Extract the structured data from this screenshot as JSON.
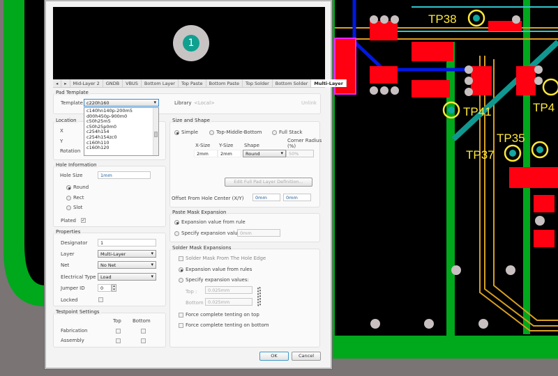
{
  "pcb": {
    "testpoints": [
      "TP38",
      "TP41",
      "TP4",
      "TP35",
      "TP37"
    ],
    "colors": {
      "board": "#000000",
      "edge": "#00a81c",
      "top": "#ff0010",
      "bottom": "#0018e0",
      "pad": "#c8c0c0",
      "testpoint_ring": "#ffe83a"
    }
  },
  "dialog": {
    "preview": {
      "designator": "1"
    },
    "tabs": [
      "◂",
      "▸",
      "Mid-Layer 2",
      "GNDB",
      "VBUS",
      "Bottom Layer",
      "Top Paste",
      "Bottom Paste",
      "Top Solder",
      "Bottom Solder",
      "Multi-Layer"
    ],
    "active_tab": "Multi-Layer",
    "pad_template": {
      "title": "Pad Template",
      "template_label": "Template",
      "template_value": "c220h160",
      "library_label": "Library",
      "library_value": "<Local>",
      "unlink": "Unlink",
      "options": [
        "c140hn140p-200m5",
        "d00h450p-900m0",
        "c50h25m5",
        "c50h25p0m0",
        "c254h154",
        "c254h154zc0",
        "c160h110",
        "c160h120"
      ]
    },
    "location": {
      "title": "Location",
      "x": "X",
      "y": "Y",
      "rotation": "Rotation"
    },
    "size_shape": {
      "title": "Size and Shape",
      "simple": "Simple",
      "tmb": "Top-Middle-Bottom",
      "full": "Full Stack",
      "xsize_label": "X-Size",
      "ysize_label": "Y-Size",
      "shape_label": "Shape",
      "corner_label": "Corner Radius (%)",
      "xsize": "2mm",
      "ysize": "2mm",
      "shape": "Round",
      "corner": "50%",
      "edit_btn": "Edit Full Pad Layer Definition...",
      "offset_label": "Offset From Hole Center (X/Y)",
      "offset_x": "0mm",
      "offset_y": "0mm"
    },
    "hole": {
      "title": "Hole Information",
      "size_label": "Hole Size",
      "size": "1mm",
      "round": "Round",
      "rect": "Rect",
      "slot": "Slot",
      "plated": "Plated"
    },
    "paste": {
      "title": "Paste Mask Expansion",
      "from_rule": "Expansion value from rule",
      "specify": "Specify expansion value",
      "value": "0mm"
    },
    "properties": {
      "title": "Properties",
      "designator_label": "Designator",
      "designator": "1",
      "layer_label": "Layer",
      "layer": "Multi-Layer",
      "net_label": "Net",
      "net": "No Net",
      "etype_label": "Electrical Type",
      "etype": "Load",
      "jumper_label": "Jumper ID",
      "jumper": "0",
      "locked_label": "Locked"
    },
    "solder": {
      "title": "Solder Mask Expansions",
      "hole_edge": "Solder Mask From The Hole Edge",
      "from_rules": "Expansion value from rules",
      "specify": "Specify expansion values:",
      "top_label": "Top :",
      "top": "0.025mm",
      "bottom_label": "Bottom :",
      "bottom": "0.025mm",
      "tent_top": "Force complete tenting on top",
      "tent_bottom": "Force complete tenting on bottom"
    },
    "testpoint": {
      "title": "Testpoint Settings",
      "top": "Top",
      "bottom": "Bottom",
      "fabrication": "Fabrication",
      "assembly": "Assembly"
    },
    "ok": "OK",
    "cancel": "Cancel"
  }
}
